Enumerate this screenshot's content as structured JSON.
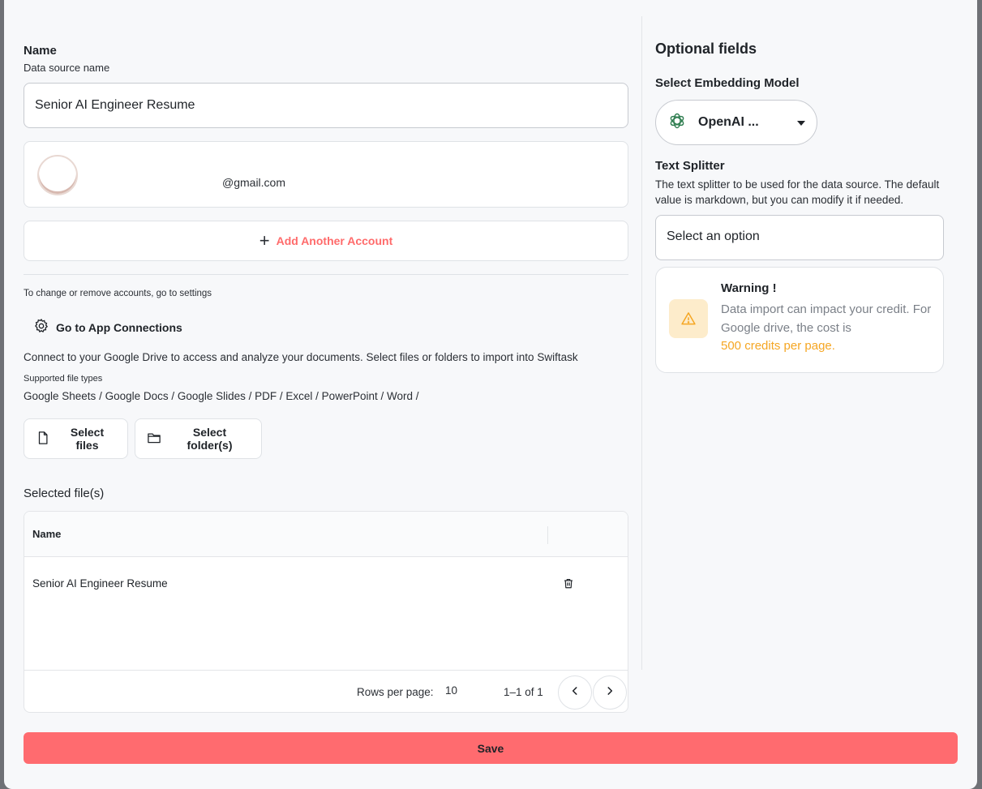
{
  "name_section": {
    "title": "Name",
    "subtitle": "Data source name",
    "input_value": "Senior AI Engineer Resume"
  },
  "account": {
    "name": "",
    "email": "@gmail.com"
  },
  "add_account_label": "Add Another Account",
  "settings_note": "To change or remove accounts, go to settings",
  "app_connections_label": "Go to App Connections",
  "connect_text": "Connect to your Google Drive to access and analyze your documents. Select files or folders to import into Swiftask",
  "supported_label": "Supported file types",
  "supported_types": "Google Sheets / Google Docs / Google Slides / PDF / Excel / PowerPoint / Word /",
  "select_files_label": "Select files",
  "select_folders_label": "Select folder(s)",
  "selected_files_label": "Selected file(s)",
  "table": {
    "header_name": "Name",
    "rows": [
      {
        "name": "Senior AI Engineer Resume"
      }
    ],
    "rows_per_page_label": "Rows per page:",
    "rows_per_page_value": "10",
    "range": "1–1 of 1"
  },
  "optional": {
    "title": "Optional fields",
    "embedding_label": "Select Embedding Model",
    "embedding_value": "OpenAI ...",
    "text_splitter_label": "Text Splitter",
    "text_splitter_desc": "The text splitter to be used for the data source. The default value is markdown, but you can modify it if needed.",
    "text_splitter_placeholder": "Select an option"
  },
  "warning": {
    "title": "Warning !",
    "body": "Data import can impact your credit. For Google drive, the cost is",
    "highlight": "500 credits per page."
  },
  "save_label": "Save",
  "colors": {
    "accent": "#ff6b6f",
    "warning": "#f5a623",
    "warning_bg": "#fdeccb"
  }
}
